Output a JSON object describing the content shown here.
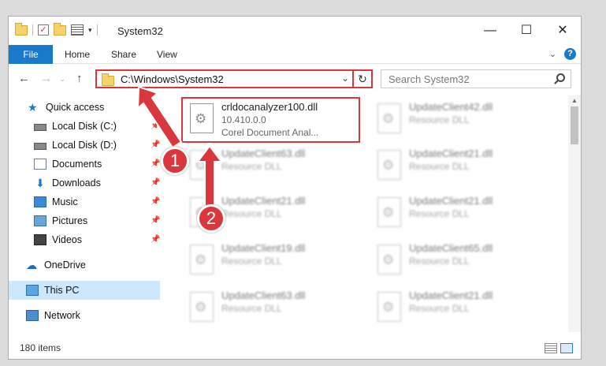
{
  "window": {
    "title": "System32",
    "min": "—",
    "max": "☐",
    "close": "✕"
  },
  "ribbon": {
    "tabs": [
      "File",
      "Home",
      "Share",
      "View"
    ]
  },
  "navbar": {
    "back": "←",
    "forward": "→",
    "up": "↑",
    "address": "C:\\Windows\\System32",
    "refresh": "↻",
    "search_placeholder": "Search System32"
  },
  "sidebar": {
    "items": [
      {
        "label": "Quick access"
      },
      {
        "label": "Local Disk (C:)"
      },
      {
        "label": "Local Disk (D:)"
      },
      {
        "label": "Documents"
      },
      {
        "label": "Downloads"
      },
      {
        "label": "Music"
      },
      {
        "label": "Pictures"
      },
      {
        "label": "Videos"
      },
      {
        "label": "OneDrive"
      },
      {
        "label": "This PC"
      },
      {
        "label": "Network"
      }
    ]
  },
  "files": {
    "main": {
      "name": "crldocanalyzer100.dll",
      "version": "10.410.0.0",
      "desc": "Corel Document Anal..."
    },
    "others": [
      {
        "name": "UpdateClient42.dll",
        "desc": "Resource DLL"
      },
      {
        "name": "UpdateClient63.dll",
        "desc": "Resource DLL"
      },
      {
        "name": "UpdateClient21.dll",
        "desc": "Resource DLL"
      },
      {
        "name": "UpdateClient21.dll",
        "desc": "Resource DLL"
      },
      {
        "name": "UpdateClient21.dll",
        "desc": "Resource DLL"
      },
      {
        "name": "UpdateClient19.dll",
        "desc": "Resource DLL"
      },
      {
        "name": "UpdateClient65.dll",
        "desc": "Resource DLL"
      },
      {
        "name": "UpdateClient63.dll",
        "desc": "Resource DLL"
      },
      {
        "name": "UpdateClient21.dll",
        "desc": "Resource DLL"
      }
    ]
  },
  "status": {
    "count": "180 items"
  },
  "annotations": {
    "badge1": "1",
    "badge2": "2",
    "color": "#d9373b"
  }
}
